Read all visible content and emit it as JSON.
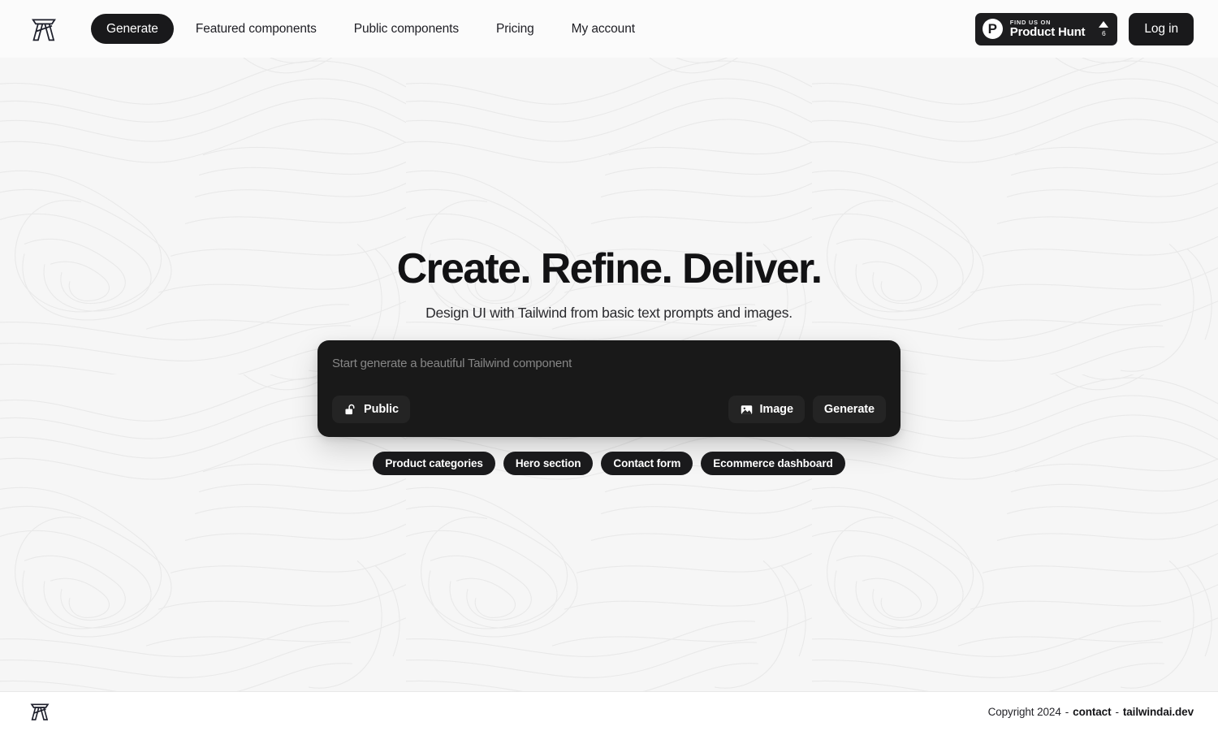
{
  "header": {
    "logo_icon": "tailwindai-monogram-logo",
    "nav": [
      {
        "label": "Generate",
        "active": true
      },
      {
        "label": "Featured components",
        "active": false
      },
      {
        "label": "Public components",
        "active": false
      },
      {
        "label": "Pricing",
        "active": false
      },
      {
        "label": "My account",
        "active": false
      }
    ],
    "product_hunt": {
      "mark": "P",
      "kicker": "FIND US ON",
      "title": "Product Hunt",
      "upvote_icon": "triangle-up-icon",
      "count": "6"
    },
    "login_label": "Log in"
  },
  "hero": {
    "title": "Create. Refine. Deliver.",
    "subtitle": "Design UI with Tailwind from basic text prompts and images."
  },
  "prompt": {
    "value": "",
    "placeholder": "Start generate a beautiful Tailwind component",
    "visibility": {
      "label": "Public",
      "icon": "unlock-icon"
    },
    "image_button": {
      "label": "Image",
      "icon": "image-icon"
    },
    "generate_button": {
      "label": "Generate"
    }
  },
  "suggestions": [
    {
      "label": "Product categories"
    },
    {
      "label": "Hero section"
    },
    {
      "label": "Contact form"
    },
    {
      "label": "Ecommerce dashboard"
    }
  ],
  "footer": {
    "logo_icon": "tailwindai-monogram-logo",
    "copyright": "Copyright 2024",
    "separator_1": "-",
    "contact_label": "contact",
    "separator_2": "-",
    "site_label": "tailwindai.dev"
  },
  "colors": {
    "ink": "#19191b",
    "page_bg": "#f6f6f6",
    "card_bg": "#191919",
    "card_btn_bg": "#242424",
    "header_bg": "#fbfbfb"
  }
}
